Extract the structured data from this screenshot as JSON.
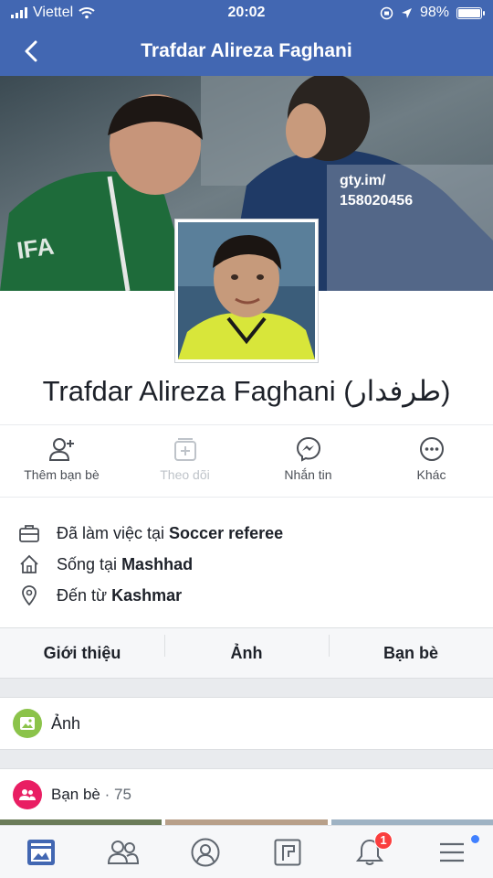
{
  "status_bar": {
    "carrier": "Viettel",
    "time": "20:02",
    "battery": "98%",
    "battery_level": 0.98
  },
  "nav": {
    "title": "Trafdar Alireza Faghani",
    "back_icon": "chevron-left-icon"
  },
  "cover": {
    "watermark_line1": "gty.im/",
    "watermark_line2": "158020456"
  },
  "profile": {
    "name": "Trafdar Alireza Faghani (طرفدار)"
  },
  "actions": [
    {
      "label": "Thêm bạn bè",
      "icon": "add-friend-icon",
      "enabled": true
    },
    {
      "label": "Theo dõi",
      "icon": "follow-icon",
      "enabled": false
    },
    {
      "label": "Nhắn tin",
      "icon": "messenger-icon",
      "enabled": true
    },
    {
      "label": "Khác",
      "icon": "more-icon",
      "enabled": true
    }
  ],
  "info": {
    "work_prefix": "Đã làm việc tại",
    "work_value": "Soccer referee",
    "lives_prefix": "Sống tại",
    "lives_value": "Mashhad",
    "from_prefix": "Đến từ",
    "from_value": "Kashmar"
  },
  "tabs": [
    "Giới thiệu",
    "Ảnh",
    "Bạn bè"
  ],
  "photos_section": {
    "title": "Ảnh",
    "icon": "photos-icon"
  },
  "friends_section": {
    "title": "Bạn bè",
    "separator": " · ",
    "count": "75",
    "icon": "friends-icon"
  },
  "bottom_bar": {
    "notifications_badge": "1",
    "items": [
      "news-feed-icon",
      "friend-requests-icon",
      "profile-icon",
      "pages-icon",
      "notifications-icon",
      "menu-icon"
    ]
  },
  "colors": {
    "brand_blue": "#4267b2",
    "photos_green": "#8bc34a",
    "friends_pink": "#e91e63",
    "badge_red": "#fa3e3e"
  }
}
